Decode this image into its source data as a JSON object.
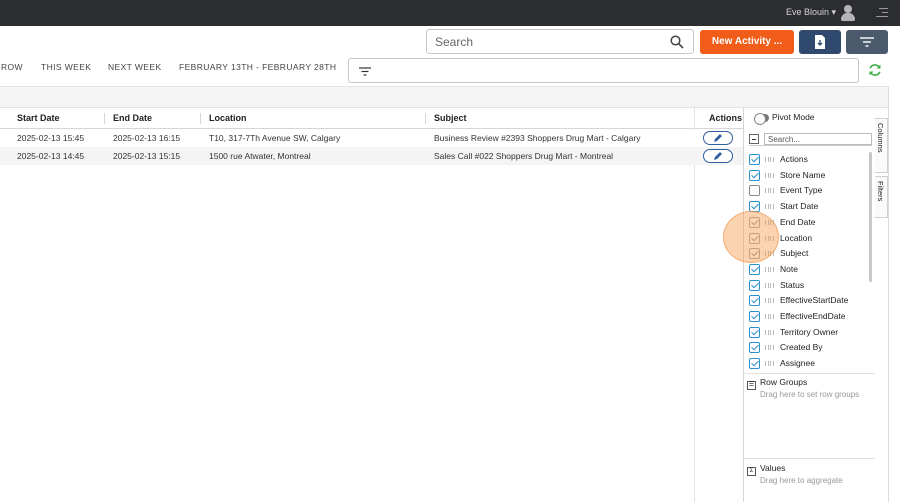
{
  "topbar": {
    "user_name": "Eve Blouin ▾"
  },
  "toolbar": {
    "search_placeholder": "Search",
    "new_activity_label": "New Activity ...",
    "accent_color": "#f25c19",
    "dark_button_color": "#2f4a6e"
  },
  "nav": {
    "items": [
      "ROW",
      "THIS WEEK",
      "NEXT WEEK",
      "FEBRUARY 13TH - FEBRUARY 28TH"
    ]
  },
  "grid": {
    "columns": [
      "Start Date",
      "End Date",
      "Location",
      "Subject",
      "Actions"
    ],
    "rows": [
      {
        "start": "2025-02-13 15:45",
        "end": "2025-02-13 16:15",
        "location": "T10, 317-7Th Avenue SW, Calgary",
        "subject": "Business Review #2393 Shoppers Drug Mart - Calgary"
      },
      {
        "start": "2025-02-13 14:45",
        "end": "2025-02-13 15:15",
        "location": "1500 rue Atwater, Montreal",
        "subject": "Sales Call #022 Shoppers Drug Mart - Montreal"
      }
    ]
  },
  "panel": {
    "pivot_label": "Pivot Mode",
    "search_placeholder": "Search...",
    "columns": [
      {
        "label": "Actions",
        "checked": true
      },
      {
        "label": "Store Name",
        "checked": true
      },
      {
        "label": "Event Type",
        "checked": false
      },
      {
        "label": "Start Date",
        "checked": true
      },
      {
        "label": "End Date",
        "checked": true
      },
      {
        "label": "Location",
        "checked": true
      },
      {
        "label": "Subject",
        "checked": true
      },
      {
        "label": "Note",
        "checked": true
      },
      {
        "label": "Status",
        "checked": true
      },
      {
        "label": "EffectiveStartDate",
        "checked": true
      },
      {
        "label": "EffectiveEndDate",
        "checked": true
      },
      {
        "label": "Territory Owner",
        "checked": true
      },
      {
        "label": "Created By",
        "checked": true
      },
      {
        "label": "Assignee",
        "checked": true
      }
    ],
    "row_groups_label": "Row Groups",
    "row_groups_hint": "Drag here to set row groups",
    "values_label": "Values",
    "values_hint": "Drag here to aggregate"
  },
  "side_tabs": {
    "columns": "Columns",
    "filters": "Filters"
  }
}
